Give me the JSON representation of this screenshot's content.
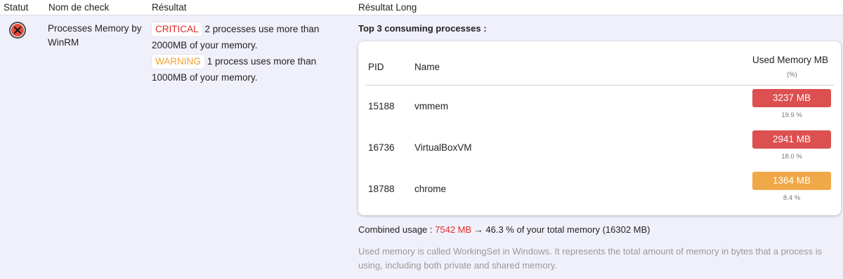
{
  "table": {
    "headers": {
      "status": "Statut",
      "check_name": "Nom de check",
      "result": "Résultat",
      "long_result": "Résultat Long"
    }
  },
  "row": {
    "status": "critical",
    "check_name": "Processes Memory by WinRM",
    "results": [
      {
        "badge": "CRITICAL",
        "level": "critical",
        "text": "2 processes use more than",
        "text2": "2000MB of your memory."
      },
      {
        "badge": "WARNING",
        "level": "warning",
        "text": "1 process uses more than",
        "text2": "1000MB of your memory."
      }
    ],
    "long": {
      "title": "Top 3 consuming processes :",
      "columns": {
        "pid": "PID",
        "name": "Name",
        "mem": "Used Memory MB",
        "mem_sub": "(%)"
      },
      "processes": [
        {
          "pid": "15188",
          "name": "vmmem",
          "mem": "3237 MB",
          "pct": "19.9 %",
          "level": "critical"
        },
        {
          "pid": "16736",
          "name": "VirtualBoxVM",
          "mem": "2941 MB",
          "pct": "18.0 %",
          "level": "critical"
        },
        {
          "pid": "18788",
          "name": "chrome",
          "mem": "1364 MB",
          "pct": "8.4 %",
          "level": "warning"
        }
      ],
      "combined_label": "Combined usage : ",
      "combined_value": "7542 MB",
      "combined_rest": " → 46.3 % of your total memory (16302 MB)",
      "note": "Used memory is called WorkingSet in Windows. It represents the total amount of memory in bytes that a process is using, including both private and shared memory."
    }
  },
  "colors": {
    "critical": "#dc5050",
    "warning": "#f0a848",
    "critical_text": "#e02a2a",
    "warning_text": "#f0a030",
    "row_bg": "#f0f0fa"
  },
  "icons": {
    "status": "critical-x-icon"
  }
}
